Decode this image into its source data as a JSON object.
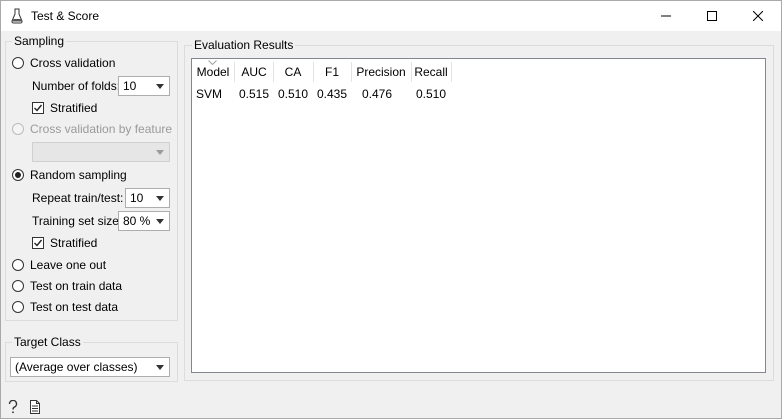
{
  "window": {
    "title": "Test & Score"
  },
  "sampling": {
    "group_title": "Sampling",
    "cross_validation": {
      "label": "Cross validation",
      "checked": false
    },
    "number_of_folds": {
      "label": "Number of folds:",
      "value": "10"
    },
    "stratified_1": {
      "label": "Stratified",
      "checked": true
    },
    "cv_by_feature": {
      "label": "Cross validation by feature",
      "enabled": false,
      "value": ""
    },
    "random_sampling": {
      "label": "Random sampling",
      "checked": true
    },
    "repeat_train_test": {
      "label": "Repeat train/test:",
      "value": "10"
    },
    "training_set_size": {
      "label": "Training set size:",
      "value": "80 %"
    },
    "stratified_2": {
      "label": "Stratified",
      "checked": true
    },
    "leave_one_out": {
      "label": "Leave one out",
      "checked": false
    },
    "test_on_train": {
      "label": "Test on train data",
      "checked": false
    },
    "test_on_test": {
      "label": "Test on test data",
      "checked": false
    }
  },
  "target_class": {
    "group_title": "Target Class",
    "value": "(Average over classes)"
  },
  "evaluation": {
    "group_title": "Evaluation Results",
    "columns": [
      "Model",
      "AUC",
      "CA",
      "F1",
      "Precision",
      "Recall"
    ],
    "rows": [
      [
        "SVM",
        "0.515",
        "0.510",
        "0.435",
        "0.476",
        "0.510"
      ]
    ]
  },
  "icons": [
    "app-icon",
    "minimize-icon",
    "maximize-icon",
    "close-icon",
    "help-icon",
    "report-icon"
  ]
}
